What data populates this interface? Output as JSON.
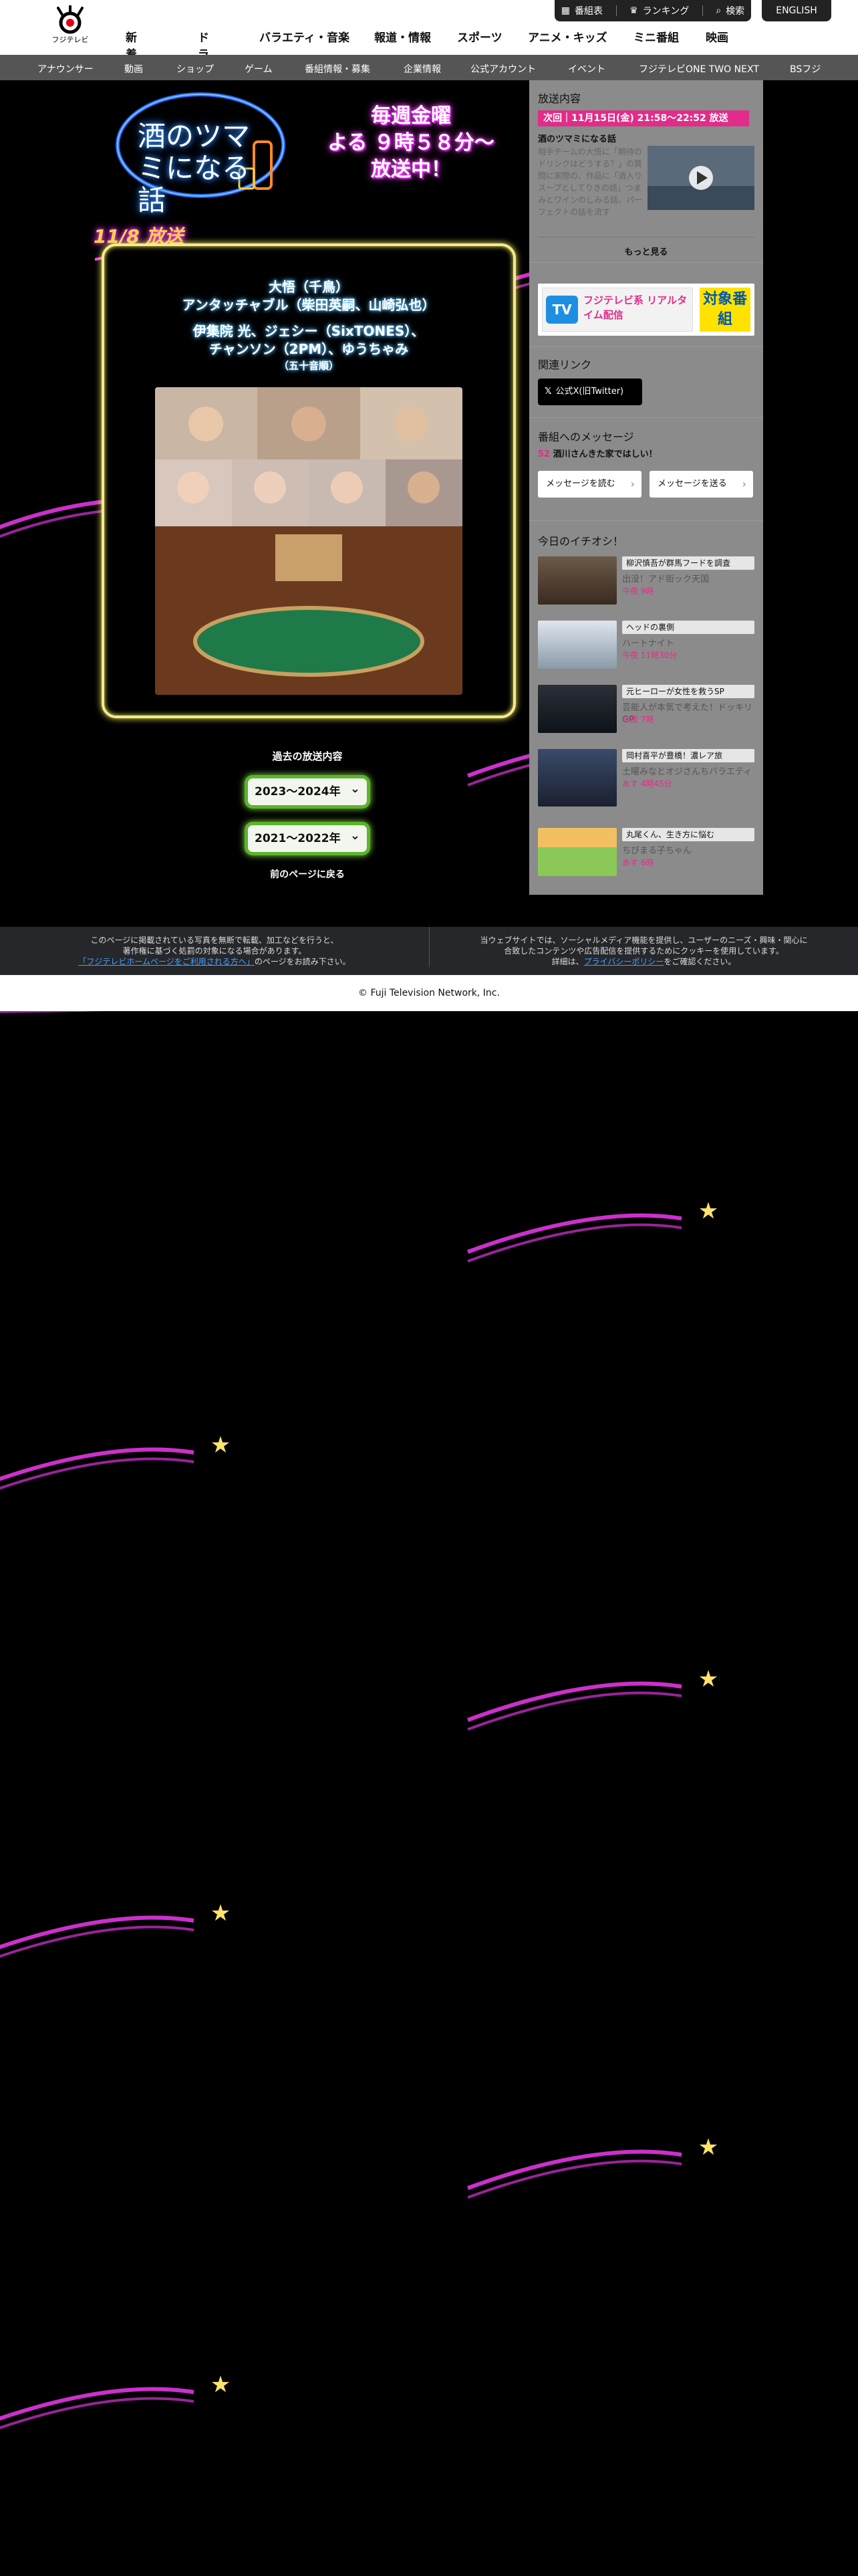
{
  "header": {
    "logo_text": "フジテレビ",
    "utils": {
      "program_table": "番組表",
      "ranking": "ランキング",
      "search": "検索"
    },
    "english": "ENGLISH",
    "nav": [
      "新着記事",
      "ドラマ",
      "バラエティ・音楽",
      "報道・情報",
      "スポーツ",
      "アニメ・キッズ",
      "ミニ番組",
      "映画"
    ],
    "subnav": [
      "アナウンサー",
      "動画",
      "ショップ",
      "ゲーム",
      "番組情報・募集",
      "企業情報",
      "公式アカウント",
      "イベント",
      "フジテレビONE TWO NEXT",
      "BSフジ"
    ]
  },
  "program": {
    "title_logo": "酒のツマミになる話",
    "slogan": [
      "毎週金曜",
      "よる ９時５８分～",
      "放送中！"
    ],
    "episode_date": "11/8 放送",
    "cast_lines": [
      {
        "text": "大悟（千鳥）",
        "size": "l"
      },
      {
        "text": "アンタッチャブル（柴田英嗣、山崎弘也）",
        "size": "l"
      },
      {
        "text": "伊集院 光、ジェシー（SixTONES）、",
        "size": "l"
      },
      {
        "text": "チャンソン（2PM）、ゆうちゃみ",
        "size": "l"
      },
      {
        "text": "（五十音順）",
        "size": "s"
      }
    ],
    "history_title": "過去の放送内容",
    "history_options": [
      "2023〜2024年",
      "2021〜2022年"
    ],
    "back_link": "前のページに戻る"
  },
  "sidebar": {
    "broadcast_heading": "放送内容",
    "next_broadcast": "次回｜11月15日(金) 21:58〜22:52 放送",
    "episode_title": "酒のツマミになる話",
    "episode_desc": "相手チームの大悟に「期待のドリンクはどうする？」の質問に実際の、作品に「酒入りスープとしてりきの話」つまみとワインのしみる話、パーフェクトの話を流す",
    "more": "もっと見る",
    "tver_text": "フジテレビ系 リアルタイム配信",
    "tver_badge": "対象番組",
    "related_heading": "関連リンク",
    "x_button": "公式X(旧Twitter)",
    "message_heading": "番組へのメッセージ",
    "message_count_num": "52",
    "message_count_text": "酒川さんきた家ではしい！",
    "read_messages": "メッセージを読む",
    "send_message": "メッセージを送る",
    "pickup_heading": "今日のイチオシ！",
    "pickups": [
      {
        "tag": "柳沢慎吾が群馬フードを調査",
        "title": "出没！アド街ック天国",
        "date": "今夜 9時"
      },
      {
        "tag": "ヘッドの裏側",
        "title": "ハートナイト",
        "date": "今夜 11時30分"
      },
      {
        "tag": "元ヒーローが女性を救うSP",
        "title": "芸能人が本気で考えた！ドッキリGP",
        "date": "今夜 7時"
      },
      {
        "tag": "岡村喜平が豊橋！濃レア旅",
        "title": "土曜みなとオジさんちバラエティ",
        "date": "あす 4時45分"
      },
      {
        "tag": "丸尾くん、生き方に悩む",
        "title": "ちびまる子ちゃん",
        "date": "あす 6時"
      }
    ]
  },
  "footer": {
    "notice_left_1": "このページに掲載されている写真を無断で転載、加工などを行うと、",
    "notice_left_2": "著作権に基づく処罰の対象になる場合があります。",
    "notice_left_link": "「フジテレビホームページをご利用される方へ」",
    "notice_left_3": "のページをお読み下さい。",
    "notice_right_1": "当ウェブサイトでは、ソーシャルメディア機能を提供し、ユーザーのニーズ・興味・関心に",
    "notice_right_2": "合致したコンテンツや広告配信を提供するためにクッキーを使用しています。",
    "notice_right_3a": "詳細は、",
    "notice_right_link": "プライバシーポリシー",
    "notice_right_3b": "をご確認ください。",
    "copyright": "© Fuji Television Network, Inc."
  },
  "colors": {
    "accent_pink": "#e12c8a",
    "neon_yellow": "#f2ec8a",
    "select_green": "#5ab52a",
    "sidebar_gray": "#8b8b8b"
  }
}
